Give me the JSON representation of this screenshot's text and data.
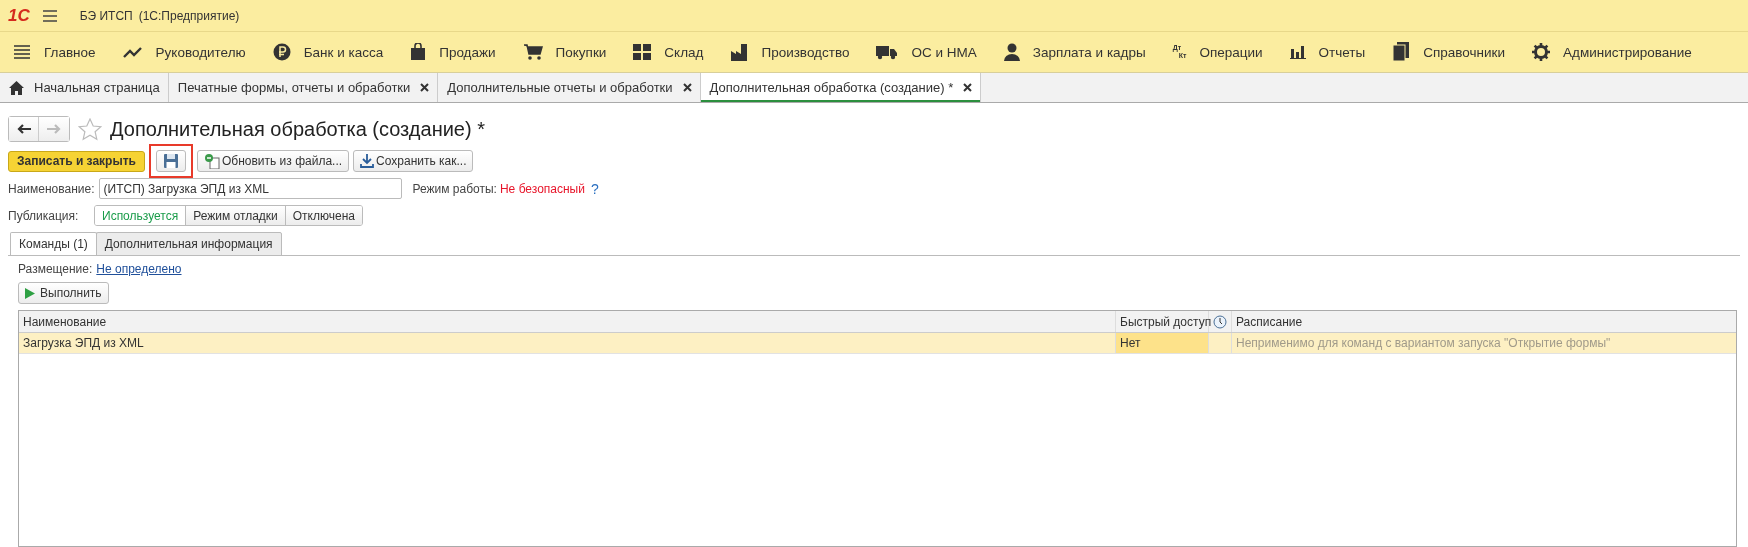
{
  "app_bar": {
    "logo": "1С",
    "title": "БЭ ИТСП",
    "subtitle": "(1С:Предприятие)"
  },
  "sections": [
    {
      "label": "Главное"
    },
    {
      "label": "Руководителю"
    },
    {
      "label": "Банк и касса"
    },
    {
      "label": "Продажи"
    },
    {
      "label": "Покупки"
    },
    {
      "label": "Склад"
    },
    {
      "label": "Производство"
    },
    {
      "label": "ОС и НМА"
    },
    {
      "label": "Зарплата и кадры"
    },
    {
      "label": "Операции",
      "icon_text": [
        "Дт",
        "Кт"
      ]
    },
    {
      "label": "Отчеты"
    },
    {
      "label": "Справочники"
    },
    {
      "label": "Администрирование"
    }
  ],
  "tabs": [
    {
      "label": "Начальная страница",
      "selected": false,
      "closable": false
    },
    {
      "label": "Печатные формы, отчеты и обработки",
      "selected": false,
      "closable": true
    },
    {
      "label": "Дополнительные отчеты и обработки",
      "selected": false,
      "closable": true
    },
    {
      "label": "Дополнительная обработка (создание) *",
      "selected": true,
      "closable": true
    }
  ],
  "form": {
    "title": "Дополнительная обработка (создание) *",
    "buttons": [
      {
        "kind": "primary",
        "label": "Записать и закрыть"
      },
      {
        "kind": "save",
        "highlighted": true
      },
      {
        "kind": "refresh",
        "label": "Обновить из файла..."
      },
      {
        "kind": "download",
        "label": "Сохранить как..."
      }
    ],
    "name_label": "Наименование:",
    "name_value": "(ИТСП) Загрузка ЭПД из XML",
    "mode_label": "Режим работы:",
    "mode_value": "Не безопасный",
    "help": "?",
    "publication_label": "Публикация:",
    "publication": [
      {
        "label": "Используется",
        "selected": true
      },
      {
        "label": "Режим отладки",
        "selected": false
      },
      {
        "label": "Отключена",
        "selected": false
      }
    ],
    "inner_tabs": [
      {
        "label": "Команды (1)",
        "selected": true
      },
      {
        "label": "Дополнительная информация",
        "selected": false
      }
    ],
    "placement_label": "Размещение:",
    "placement_value": "Не определено",
    "run_button": "Выполнить",
    "table": {
      "columns": [
        "Наименование",
        "Быстрый доступ",
        "",
        "Расписание"
      ],
      "rows": [
        {
          "name": "Загрузка ЭПД из XML",
          "quick": "Нет",
          "schedule": "Неприменимо для команд с вариантом запуска \"Открытие формы\"",
          "selected": true
        }
      ]
    }
  }
}
